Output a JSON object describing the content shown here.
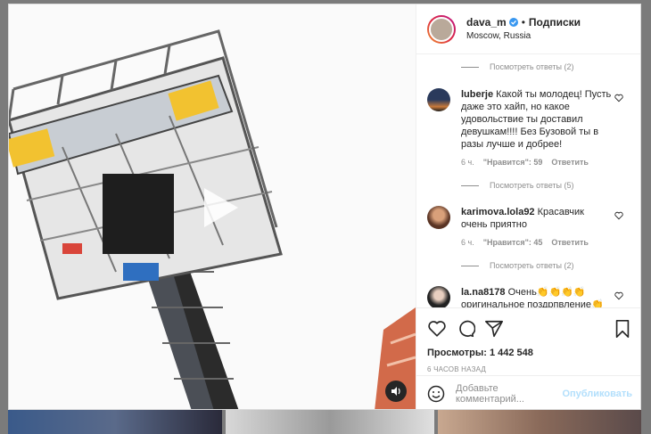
{
  "post": {
    "username": "dava_m",
    "follow_label": "Подписки",
    "location": "Moscow, Russia",
    "views_label": "Просмотры: 1 442 548",
    "time_ago": "6 ЧАСОВ НАЗАД"
  },
  "comments": [
    {
      "type": "replies",
      "label": "Посмотреть ответы (2)"
    },
    {
      "type": "comment",
      "username": "luberje",
      "text": "Какой ты молодец! Пусть даже это хайп, но какое удовольствие ты доставил девушкам!!!! Без Бузовой ты в разы лучше и добрее!",
      "time": "6 ч.",
      "likes": "\"Нравится\": 59",
      "reply": "Ответить",
      "replies": "Посмотреть ответы (5)"
    },
    {
      "type": "comment",
      "username": "karimova.lola92",
      "text": "Красавчик очень приятно",
      "time": "6 ч.",
      "likes": "\"Нравится\": 45",
      "reply": "Ответить",
      "replies": "Посмотреть ответы (2)"
    },
    {
      "type": "comment",
      "username": "la.na8178",
      "text": "Очень👏👏👏👏 оригинальное поздрпвление👏"
    }
  ],
  "add_comment": {
    "placeholder": "Добавьте комментарий...",
    "post_label": "Опубликовать"
  },
  "icons": [
    "verified-icon",
    "play-icon",
    "sound-icon",
    "heart-icon",
    "comment-icon",
    "share-icon",
    "bookmark-icon",
    "emoji-icon"
  ],
  "colors": {
    "verified": "#3897f0",
    "post_disabled": "#b2dffc",
    "muted": "#8e8e8e",
    "text": "#262626"
  }
}
